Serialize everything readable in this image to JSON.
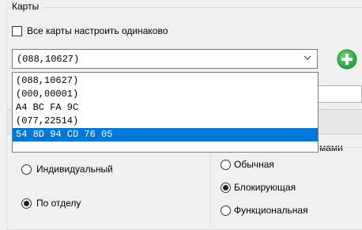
{
  "group_title": "Карты",
  "same_settings_label": "Все карты настроить одинаково",
  "combo_value": "(088,10627)",
  "dropdown_items": [
    "(088,10627)",
    "(000,00001)",
    "A4 BC FA 9C",
    "(077,22514)",
    "54 8D 94 CD 76 05"
  ],
  "selected_index": 4,
  "peek_label": "мами",
  "mode_options": [
    {
      "label": "Индивидуальный",
      "checked": false
    },
    {
      "label": "По отделу",
      "checked": true
    }
  ],
  "type_options": [
    {
      "label": "Обычная",
      "checked": false
    },
    {
      "label": "Блокирующая",
      "checked": true
    },
    {
      "label": "Функциональная",
      "checked": false
    }
  ],
  "colors": {
    "accent": "#0078d7",
    "add_green": "#2eae4a"
  },
  "icons": {
    "dropdown_arrow": "chevron-down-icon",
    "add": "plus-circle-icon"
  }
}
